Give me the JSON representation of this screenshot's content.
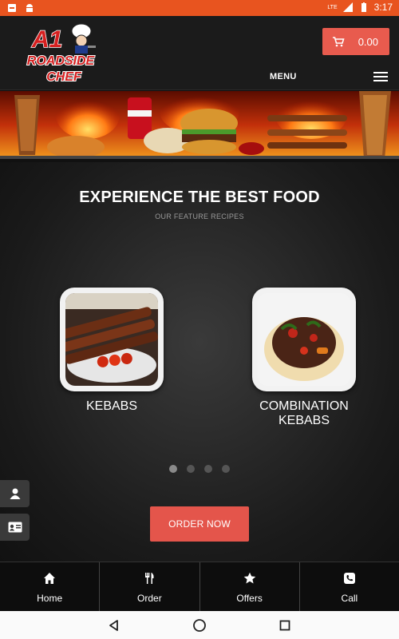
{
  "status_bar": {
    "time": "3:17",
    "network": "LTE",
    "icons": [
      "notification-icon",
      "android-icon",
      "signal-icon",
      "battery-icon"
    ]
  },
  "header": {
    "logo_text_line1": "A1",
    "logo_text_line2": "ROADSIDE",
    "logo_text_line3": "CHEF",
    "cart_total": "0.00",
    "menu_label": "MENU"
  },
  "colors": {
    "status_bar": "#e8541f",
    "accent": "#e4554b",
    "background": "#111111"
  },
  "main": {
    "title": "EXPERIENCE THE BEST FOOD",
    "subtitle": "OUR FEATURE RECIPES",
    "recipes": [
      {
        "label": "KEBABS"
      },
      {
        "label": "COMBINATION KEBABS"
      }
    ],
    "carousel_pages": 4,
    "carousel_active": 1,
    "order_button": "ORDER NOW"
  },
  "bottom_nav": {
    "items": [
      {
        "label": "Home",
        "icon": "home-icon"
      },
      {
        "label": "Order",
        "icon": "cutlery-icon"
      },
      {
        "label": "Offers",
        "icon": "star-icon"
      },
      {
        "label": "Call",
        "icon": "phone-icon"
      }
    ]
  }
}
